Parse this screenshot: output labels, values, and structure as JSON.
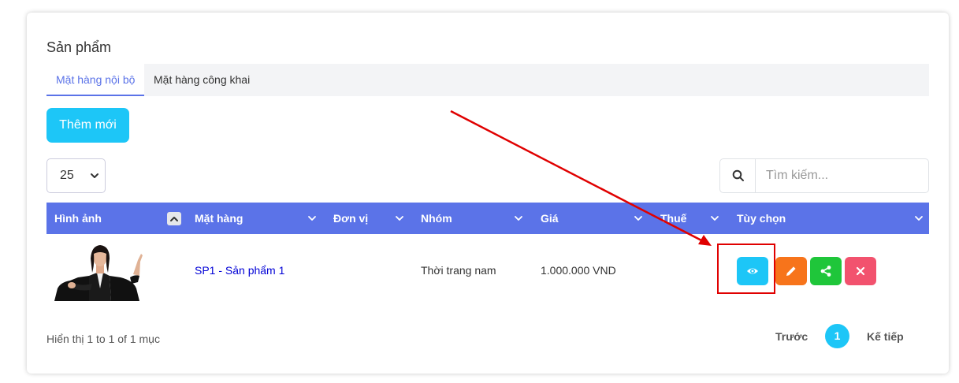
{
  "page": {
    "title": "Sản phẩm",
    "tabs": [
      {
        "label": "Mặt hàng nội bộ",
        "active": true
      },
      {
        "label": "Mặt hàng công khai",
        "active": false
      }
    ],
    "add_button": "Thêm mới",
    "page_size": "25",
    "search": {
      "placeholder": "Tìm kiếm..."
    }
  },
  "table": {
    "columns": [
      "Hình ảnh",
      "Mặt hàng",
      "Đơn vị",
      "Nhóm",
      "Giá",
      "Thuế",
      "Tùy chọn"
    ],
    "rows": [
      {
        "product": "SP1 - Sản phẩm 1",
        "unit": "",
        "group": "Thời trang nam",
        "price": "1.000.000 VND",
        "tax": ""
      }
    ]
  },
  "footer": {
    "info": "Hiển thị 1 to 1 of 1 mục",
    "prev": "Trước",
    "current_page": "1",
    "next": "Kế tiếp"
  },
  "colors": {
    "primary": "#5b73e8",
    "info": "#1dc6f7",
    "warning": "#f7741b",
    "success": "#1fc63a",
    "danger": "#f2526e",
    "annotation": "#e00000"
  },
  "icons": {
    "search": "search-icon",
    "view": "eye-icon",
    "edit": "pencil-icon",
    "share": "share-icon",
    "delete": "close-icon"
  }
}
